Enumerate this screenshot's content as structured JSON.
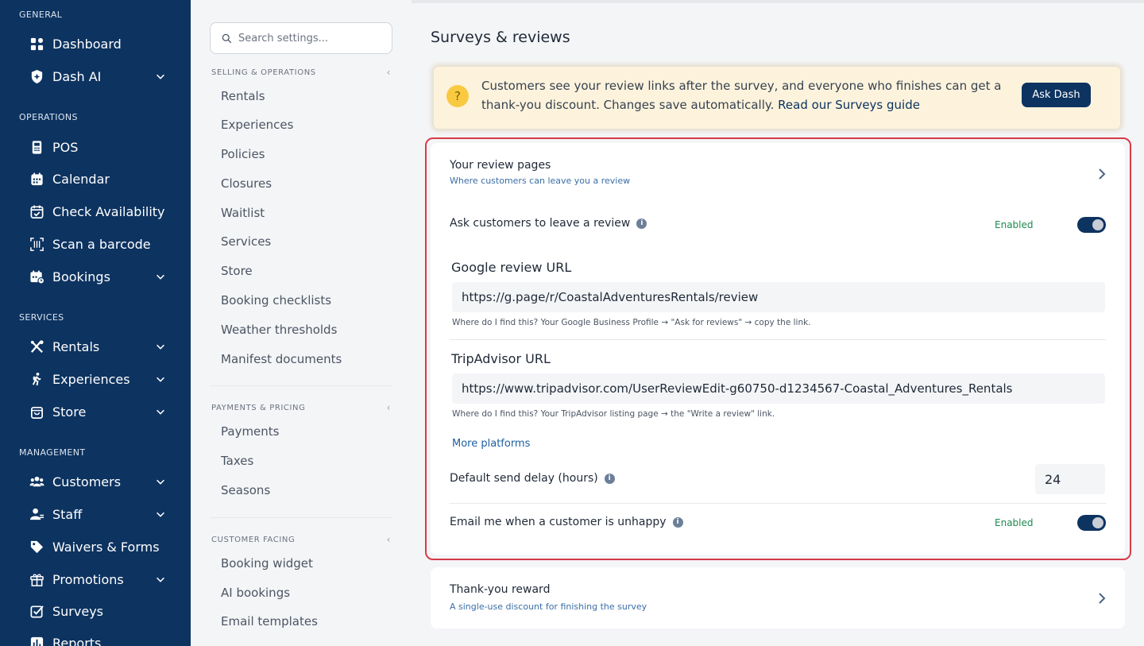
{
  "sidebar": {
    "sections": [
      {
        "title": "GENERAL",
        "items": [
          {
            "label": "Dashboard",
            "icon": "grid-icon",
            "expandable": false
          },
          {
            "label": "Dash AI",
            "icon": "sparkle-shield-icon",
            "expandable": true
          }
        ]
      },
      {
        "title": "OPERATIONS",
        "items": [
          {
            "label": "POS",
            "icon": "pos-terminal-icon",
            "expandable": false
          },
          {
            "label": "Calendar",
            "icon": "calendar-icon",
            "expandable": false
          },
          {
            "label": "Check Availability",
            "icon": "calendar-check-icon",
            "expandable": false
          },
          {
            "label": "Scan a barcode",
            "icon": "barcode-scan-icon",
            "expandable": false
          },
          {
            "label": "Bookings",
            "icon": "bookings-icon",
            "expandable": true
          }
        ]
      },
      {
        "title": "SERVICES",
        "items": [
          {
            "label": "Rentals",
            "icon": "rentals-icon",
            "expandable": true
          },
          {
            "label": "Experiences",
            "icon": "hiker-icon",
            "expandable": true
          },
          {
            "label": "Store",
            "icon": "shopping-bag-icon",
            "expandable": true
          }
        ]
      },
      {
        "title": "MANAGEMENT",
        "items": [
          {
            "label": "Customers",
            "icon": "users-icon",
            "expandable": true
          },
          {
            "label": "Staff",
            "icon": "staff-icon",
            "expandable": true
          },
          {
            "label": "Waivers & Forms",
            "icon": "tag-icon",
            "expandable": false
          },
          {
            "label": "Promotions",
            "icon": "gift-icon",
            "expandable": true
          },
          {
            "label": "Surveys",
            "icon": "checkbox-icon",
            "expandable": false
          },
          {
            "label": "Reports",
            "icon": "bar-chart-icon",
            "expandable": false
          }
        ]
      }
    ]
  },
  "settings_nav": {
    "search_placeholder": "Search settings...",
    "groups": [
      {
        "title": "SELLING & OPERATIONS",
        "items": [
          "Rentals",
          "Experiences",
          "Policies",
          "Closures",
          "Waitlist",
          "Services",
          "Store",
          "Booking checklists",
          "Weather thresholds",
          "Manifest documents"
        ]
      },
      {
        "title": "PAYMENTS & PRICING",
        "items": [
          "Payments",
          "Taxes",
          "Seasons"
        ]
      },
      {
        "title": "CUSTOMER FACING",
        "items": [
          "Booking widget",
          "AI bookings",
          "Email templates"
        ]
      }
    ],
    "collapse_glyph": "‹"
  },
  "main": {
    "title": "Surveys & reviews",
    "banner": {
      "icon": "?",
      "text": "Customers see your review links after the survey, and everyone who finishes can get a thank-you discount. Changes save automatically. ",
      "link": "Read our Surveys guide",
      "button": "Ask Dash"
    },
    "review_card": {
      "title": "Your review pages",
      "subtitle": "Where customers can leave you a review",
      "ask_review": {
        "label": "Ask customers to leave a review",
        "status": "Enabled",
        "on": true
      },
      "google": {
        "label": "Google review URL",
        "value": "https://g.page/r/CoastalAdventuresRentals/review",
        "hint": "Where do I find this? Your Google Business Profile → \"Ask for reviews\" → copy the link."
      },
      "tripadvisor": {
        "label": "TripAdvisor URL",
        "value": "https://www.tripadvisor.com/UserReviewEdit-g60750-d1234567-Coastal_Adventures_Rentals",
        "hint": "Where do I find this? Your TripAdvisor listing page → the \"Write a review\" link."
      },
      "more_platforms": "More platforms",
      "delay": {
        "label": "Default send delay (hours)",
        "value": "24"
      },
      "unhappy": {
        "label": "Email me when a customer is unhappy",
        "status": "Enabled",
        "on": true
      }
    },
    "reward_card": {
      "title": "Thank-you reward",
      "subtitle": "A single-use discount for finishing the survey"
    }
  },
  "colors": {
    "sidebar_bg": "#0d3360",
    "accent": "#0d3360",
    "enabled_text": "#1e8a4f",
    "highlight_border": "#d83a4a",
    "banner_bg": "#fdf3dc"
  }
}
